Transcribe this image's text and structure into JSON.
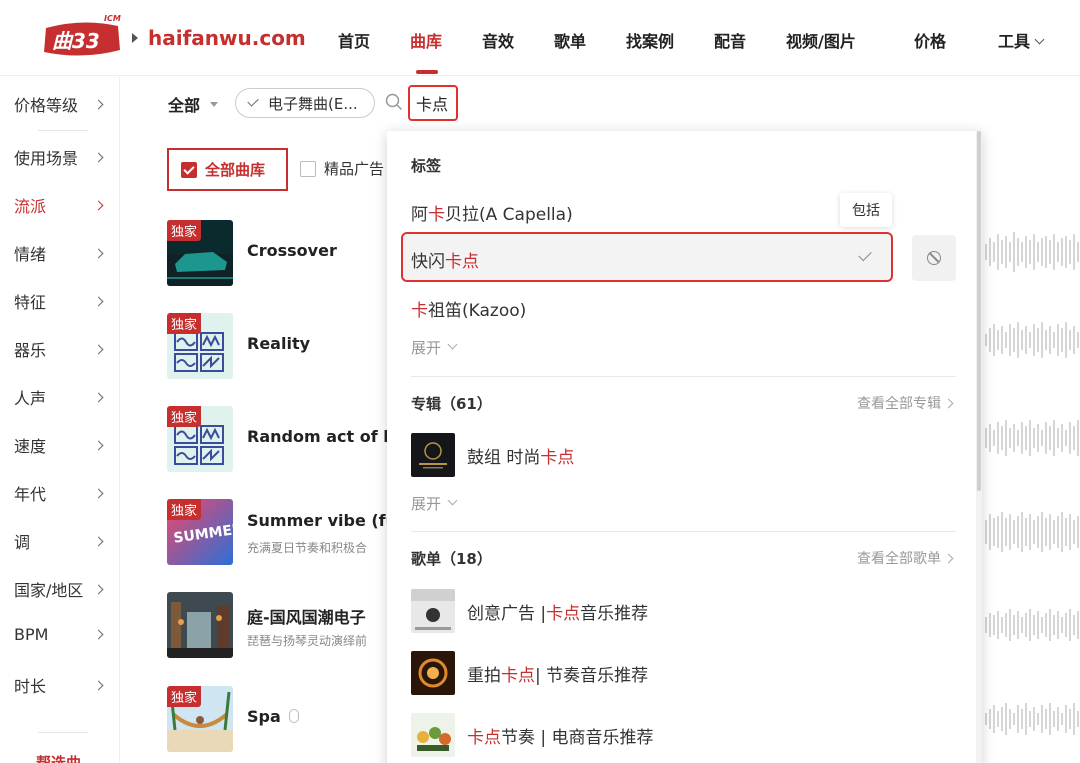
{
  "header": {
    "logo_sub": "ICM",
    "domain": "haifanwu.com",
    "nav": [
      {
        "label": "首页"
      },
      {
        "label": "曲库"
      },
      {
        "label": "音效"
      },
      {
        "label": "歌单"
      },
      {
        "label": "找案例"
      },
      {
        "label": "配音"
      },
      {
        "label": "视频/图片"
      },
      {
        "label": "价格"
      },
      {
        "label": "工具"
      }
    ],
    "active_index": 1
  },
  "sidebar": {
    "items": [
      {
        "label": "价格等级"
      },
      {
        "label": "使用场景"
      },
      {
        "label": "流派"
      },
      {
        "label": "情绪"
      },
      {
        "label": "特征"
      },
      {
        "label": "器乐"
      },
      {
        "label": "人声"
      },
      {
        "label": "速度"
      },
      {
        "label": "年代"
      },
      {
        "label": "调"
      },
      {
        "label": "国家/地区"
      },
      {
        "label": "BPM"
      },
      {
        "label": "时长"
      }
    ],
    "active_index": 2,
    "bottom_label": "帮选曲"
  },
  "filter": {
    "all_label": "全部",
    "chip_label": "电子舞曲(E...",
    "search_value": "卡点"
  },
  "library": {
    "all_label": "全部曲库",
    "ad_label": "精品广告"
  },
  "tracks": [
    {
      "badge": "独家",
      "title": "Crossover",
      "desc": ""
    },
    {
      "badge": "独家",
      "title": "Reality",
      "desc": ""
    },
    {
      "badge": "独家",
      "title": "Random act of k",
      "desc": ""
    },
    {
      "badge": "独家",
      "title": "Summer vibe (fu",
      "desc": "充满夏日节奏和积极合"
    },
    {
      "badge": "",
      "title": "庭-国风国潮电子",
      "desc": "琵琶与扬琴灵动演绎前"
    },
    {
      "badge": "独家",
      "title": "Spa",
      "desc": ""
    }
  ],
  "dropdown": {
    "tags_title": "标签",
    "tags": [
      {
        "pre": "阿",
        "hl": "卡",
        "post": "贝拉(A Capella)"
      },
      {
        "pre": "快闪",
        "hl": "卡点",
        "post": ""
      },
      {
        "pre": "",
        "hl": "卡",
        "post": "祖笛(Kazoo)"
      }
    ],
    "tooltip": "包括",
    "expand_label": "展开",
    "albums_title": "专辑（61）",
    "albums_view_all": "查看全部专辑",
    "albums": [
      {
        "pre": "鼓组 时尚",
        "hl": "卡点",
        "post": ""
      }
    ],
    "playlists_title": "歌单（18）",
    "playlists_view_all": "查看全部歌单",
    "playlists": [
      {
        "pre": "创意广告 | ",
        "hl": "卡点",
        "post": "音乐推荐"
      },
      {
        "pre": "重拍",
        "hl": "卡点",
        "post": " | 节奏音乐推荐"
      },
      {
        "pre": "",
        "hl": "卡点",
        "post": "节奏 | 电商音乐推荐"
      }
    ]
  },
  "colors": {
    "brand": "#c52f2f",
    "highlight_border": "#e03131"
  }
}
